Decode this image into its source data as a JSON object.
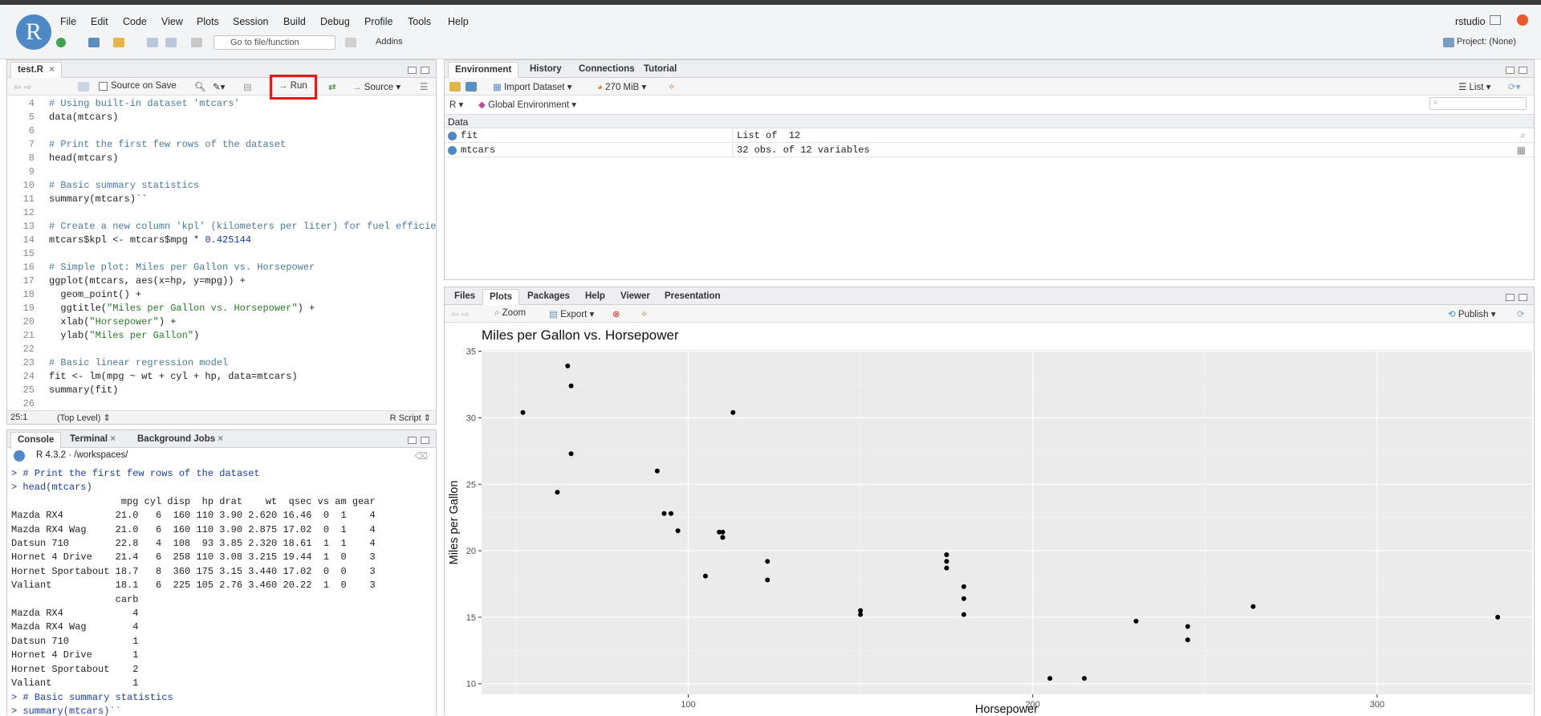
{
  "app": {
    "logo": "R",
    "user": "rstudio",
    "project": "Project: (None)"
  },
  "menu": [
    "File",
    "Edit",
    "Code",
    "View",
    "Plots",
    "Session",
    "Build",
    "Debug",
    "Profile",
    "Tools",
    "Help"
  ],
  "toolbar": {
    "goto_placeholder": "Go to file/function",
    "addins": "Addins"
  },
  "editor": {
    "tab": "test.R",
    "source_on_save": "Source on Save",
    "run": "Run",
    "source": "Source",
    "line_numbers": [
      "4",
      "5",
      "6",
      "7",
      "8",
      "9",
      "10",
      "11",
      "12",
      "13",
      "14",
      "15",
      "16",
      "17",
      "18",
      "19",
      "20",
      "21",
      "22",
      "23",
      "24",
      "25",
      "26"
    ],
    "status_pos": "25:1",
    "status_scope": "(Top Level)",
    "status_type": "R Script"
  },
  "environment": {
    "tabs": [
      "Environment",
      "History",
      "Connections",
      "Tutorial"
    ],
    "import": "Import Dataset",
    "memory": "270 MiB",
    "view": "List",
    "lang": "R",
    "scope": "Global Environment",
    "section": "Data",
    "rows": [
      {
        "name": "fit",
        "value": "List of  12"
      },
      {
        "name": "mtcars",
        "value": "32 obs. of 12 variables"
      }
    ]
  },
  "console": {
    "tabs": [
      "Console",
      "Terminal",
      "Background Jobs"
    ],
    "version": "R 4.3.2 · /workspaces/",
    "lines": [
      "> # Print the first few rows of the dataset",
      "> head(mtcars)",
      "                   mpg cyl disp  hp drat    wt  qsec vs am gear",
      "Mazda RX4         21.0   6  160 110 3.90 2.620 16.46  0  1    4",
      "Mazda RX4 Wag     21.0   6  160 110 3.90 2.875 17.02  0  1    4",
      "Datsun 710        22.8   4  108  93 3.85 2.320 18.61  1  1    4",
      "Hornet 4 Drive    21.4   6  258 110 3.08 3.215 19.44  1  0    3",
      "Hornet Sportabout 18.7   8  360 175 3.15 3.440 17.02  0  0    3",
      "Valiant           18.1   6  225 105 2.76 3.460 20.22  1  0    3",
      "                  carb",
      "Mazda RX4            4",
      "Mazda RX4 Wag        4",
      "Datsun 710           1",
      "Hornet 4 Drive       1",
      "Hornet Sportabout    2",
      "Valiant              1",
      "> # Basic summary statistics",
      "> summary(mtcars)``"
    ]
  },
  "plots": {
    "tabs": [
      "Files",
      "Plots",
      "Packages",
      "Help",
      "Viewer",
      "Presentation"
    ],
    "zoom": "Zoom",
    "export": "Export",
    "publish": "Publish"
  },
  "chart_data": {
    "type": "scatter",
    "title": "Miles per Gallon vs. Horsepower",
    "xlabel": "Horsepower",
    "ylabel": "Miles per Gallon",
    "xlim": [
      40,
      345
    ],
    "ylim": [
      9.2,
      35.1
    ],
    "xticks": [
      100,
      200,
      300
    ],
    "yticks": [
      10,
      15,
      20,
      25,
      30,
      35
    ],
    "grid": true,
    "points": [
      [
        110,
        21.0
      ],
      [
        110,
        21.0
      ],
      [
        93,
        22.8
      ],
      [
        110,
        21.4
      ],
      [
        175,
        18.7
      ],
      [
        105,
        18.1
      ],
      [
        245,
        14.3
      ],
      [
        62,
        24.4
      ],
      [
        95,
        22.8
      ],
      [
        123,
        19.2
      ],
      [
        123,
        17.8
      ],
      [
        180,
        16.4
      ],
      [
        180,
        17.3
      ],
      [
        180,
        15.2
      ],
      [
        205,
        10.4
      ],
      [
        215,
        10.4
      ],
      [
        230,
        14.7
      ],
      [
        66,
        32.4
      ],
      [
        52,
        30.4
      ],
      [
        65,
        33.9
      ],
      [
        97,
        21.5
      ],
      [
        150,
        15.5
      ],
      [
        150,
        15.2
      ],
      [
        245,
        13.3
      ],
      [
        175,
        19.2
      ],
      [
        66,
        27.3
      ],
      [
        91,
        26.0
      ],
      [
        113,
        30.4
      ],
      [
        264,
        15.8
      ],
      [
        175,
        19.7
      ],
      [
        335,
        15.0
      ],
      [
        109,
        21.4
      ]
    ]
  }
}
